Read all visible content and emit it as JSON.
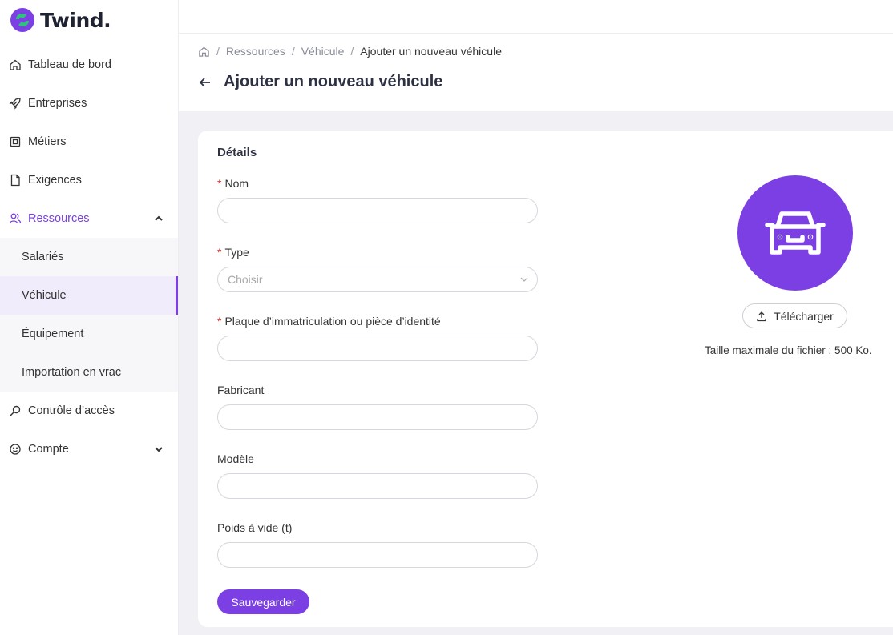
{
  "app": {
    "name": "Twind."
  },
  "sidebar": {
    "items": [
      {
        "label": "Tableau de bord",
        "icon": "home-icon"
      },
      {
        "label": "Entreprises",
        "icon": "rocket-icon"
      },
      {
        "label": "Métiers",
        "icon": "clipboard-icon"
      },
      {
        "label": "Exigences",
        "icon": "document-icon"
      },
      {
        "label": "Ressources",
        "icon": "users-icon"
      },
      {
        "label": "Contrôle d’accès",
        "icon": "key-icon"
      },
      {
        "label": "Compte",
        "icon": "smiley-icon"
      }
    ],
    "subitems": [
      {
        "label": "Salariés"
      },
      {
        "label": "Véhicule"
      },
      {
        "label": "Équipement"
      },
      {
        "label": "Importation en vrac"
      }
    ]
  },
  "breadcrumb": {
    "items": [
      "Ressources",
      "Véhicule"
    ],
    "current": "Ajouter un nouveau véhicule"
  },
  "page": {
    "title": "Ajouter un nouveau véhicule"
  },
  "form": {
    "section_title": "Détails",
    "fields": [
      {
        "label": "Nom",
        "required": true,
        "value": ""
      },
      {
        "label": "Type",
        "required": true,
        "placeholder": "Choisir"
      },
      {
        "label": "Plaque d’immatriculation ou pièce d’identité",
        "required": true,
        "value": ""
      },
      {
        "label": "Fabricant",
        "required": false,
        "value": ""
      },
      {
        "label": "Modèle",
        "required": false,
        "value": ""
      },
      {
        "label": "Poids à vide (t)",
        "required": false,
        "value": ""
      }
    ],
    "save_label": "Sauvegarder"
  },
  "upload": {
    "button_label": "Télécharger",
    "max_size": "Taille maximale du fichier : 500 Ko."
  },
  "colors": {
    "accent": "#7b3fe4",
    "required": "#d93737",
    "logo_green": "#2ec27e"
  }
}
